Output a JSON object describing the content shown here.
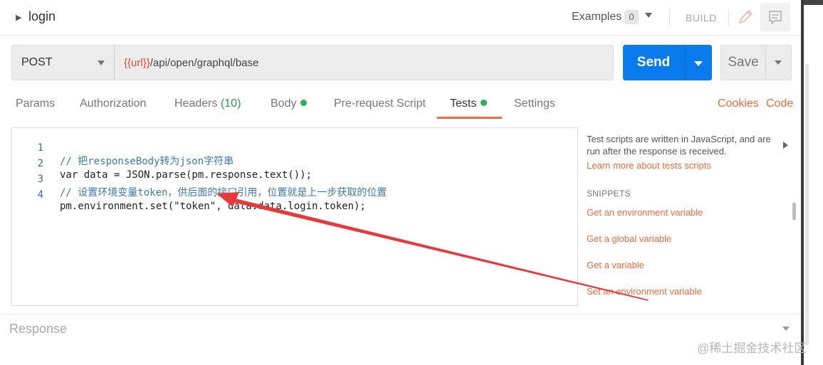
{
  "header": {
    "title": "login",
    "examples_label": "Examples",
    "examples_count": "0",
    "build_label": "BUILD"
  },
  "request": {
    "method": "POST",
    "url_variable": "{{url}}",
    "url_path": "/api/open/graphql/base",
    "send_label": "Send",
    "save_label": "Save"
  },
  "tabs": [
    {
      "label": "Params"
    },
    {
      "label": "Authorization"
    },
    {
      "label": "Headers",
      "count": "(10)"
    },
    {
      "label": "Body"
    },
    {
      "label": "Pre-request Script"
    },
    {
      "label": "Tests"
    },
    {
      "label": "Settings"
    }
  ],
  "active_tab": "Tests",
  "links": {
    "cookies": "Cookies",
    "code": "Code"
  },
  "editor": {
    "lines": [
      {
        "n": "1",
        "text": "// 把responseBody转为json字符串"
      },
      {
        "n": "2",
        "text": "var data = JSON.parse(pm.response.text());"
      },
      {
        "n": "3",
        "text": "// 设置环境变量token，供后面的接口引用，位置就是上一步获取的位置"
      },
      {
        "n": "4",
        "text": "pm.environment.set(\"token\", data.data.login.token);"
      }
    ]
  },
  "panel": {
    "info": "Test scripts are written in JavaScript, and are run after the response is received.",
    "learn_link": "Learn more about tests scripts",
    "snippets_title": "SNIPPETS",
    "snippets": [
      "Get an environment variable",
      "Get a global variable",
      "Get a variable",
      "Set an environment variable"
    ]
  },
  "response": {
    "label": "Response"
  },
  "watermark": "@稀土掘金技术社区",
  "colors": {
    "send": "#097bed",
    "accent": "#f26b3a",
    "dot": "#26b35a",
    "url_variable": "#e04b36",
    "annotation_arrow": "#e8383b"
  }
}
